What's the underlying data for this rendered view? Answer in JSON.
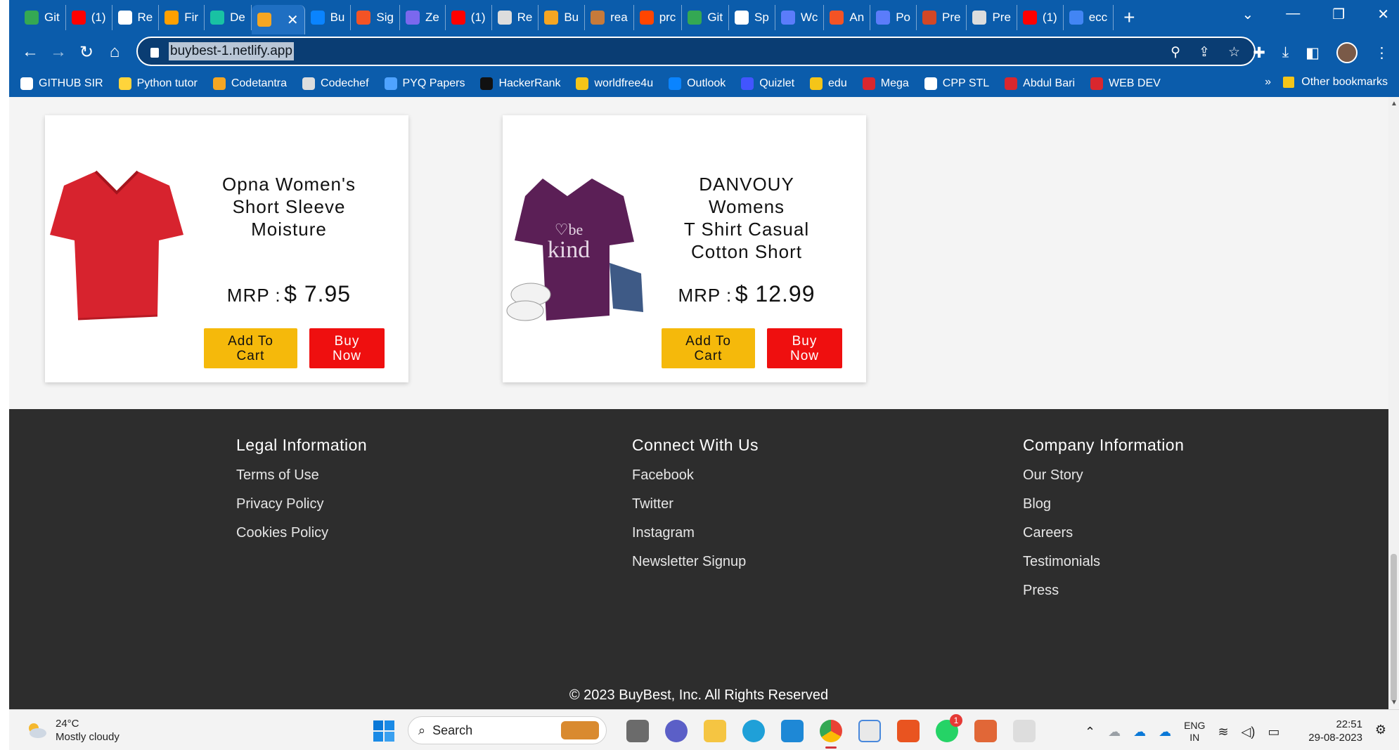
{
  "browser": {
    "tabs": [
      {
        "label": "Git",
        "color": "#34a853"
      },
      {
        "label": "(1)",
        "color": "#ff0000"
      },
      {
        "label": "Re",
        "color": "#ffffff"
      },
      {
        "label": "Fir",
        "color": "#ffa000"
      },
      {
        "label": "De",
        "color": "#19c2a3"
      },
      {
        "label": "",
        "color": "#f5a623",
        "active": true
      },
      {
        "label": "Bu",
        "color": "#0a84ff"
      },
      {
        "label": "Sig",
        "color": "#f35325"
      },
      {
        "label": "Ze",
        "color": "#7b68ee"
      },
      {
        "label": "(1)",
        "color": "#ff0000"
      },
      {
        "label": "Re",
        "color": "#dddddd"
      },
      {
        "label": "Bu",
        "color": "#f5a623"
      },
      {
        "label": "rea",
        "color": "#c67a3a"
      },
      {
        "label": "prc",
        "color": "#ff4500"
      },
      {
        "label": "Git",
        "color": "#34a853"
      },
      {
        "label": "Sp",
        "color": "#ffffff"
      },
      {
        "label": "Wc",
        "color": "#5b7cfa"
      },
      {
        "label": "An",
        "color": "#f35325"
      },
      {
        "label": "Po",
        "color": "#5b7cfa"
      },
      {
        "label": "Pre",
        "color": "#d24726"
      },
      {
        "label": "Pre",
        "color": "#dddddd"
      },
      {
        "label": "(1)",
        "color": "#ff0000"
      },
      {
        "label": "ecc",
        "color": "#4285f4"
      }
    ],
    "active_tab_close": "✕",
    "new_tab": "+",
    "window_controls": [
      "⌄",
      "—",
      "❐",
      "✕"
    ],
    "url": "buybest-1.netlify.app",
    "bookmarks": [
      {
        "label": "GITHUB SIR",
        "color": "#ffffff"
      },
      {
        "label": "Python tutor",
        "color": "#ffd43b"
      },
      {
        "label": "Codetantra",
        "color": "#f5a623"
      },
      {
        "label": "Codechef",
        "color": "#dddddd"
      },
      {
        "label": "PYQ Papers",
        "color": "#4fa3ff"
      },
      {
        "label": "HackerRank",
        "color": "#111111"
      },
      {
        "label": "worldfree4u",
        "color": "#f5c518"
      },
      {
        "label": "Outlook",
        "color": "#0a84ff"
      },
      {
        "label": "Quizlet",
        "color": "#4255ff"
      },
      {
        "label": "edu",
        "color": "#f5c518"
      },
      {
        "label": "Mega",
        "color": "#d9272e"
      },
      {
        "label": "CPP STL",
        "color": "#ffffff"
      },
      {
        "label": "Abdul Bari",
        "color": "#d9272e"
      },
      {
        "label": "WEB DEV",
        "color": "#d9272e"
      }
    ],
    "bookmarks_more": "»",
    "other_bookmarks": "Other bookmarks"
  },
  "products": [
    {
      "title_lines": [
        "Opna Women's",
        "Short Sleeve",
        "Moisture"
      ],
      "mrp_label": "MRP :",
      "price": "$ 7.95",
      "add_to_cart": [
        "Add To",
        "Cart"
      ],
      "buy_now": [
        "Buy",
        "Now"
      ],
      "image": "red-tshirt"
    },
    {
      "title_lines": [
        "DANVOUY Womens",
        "T Shirt Casual",
        "Cotton Short"
      ],
      "mrp_label": "MRP :",
      "price": "$ 12.99",
      "add_to_cart": [
        "Add To",
        "Cart"
      ],
      "buy_now": [
        "Buy",
        "Now"
      ],
      "image": "purple-be-kind-tshirt",
      "image_text": [
        "♡be",
        "kind"
      ]
    }
  ],
  "footer": {
    "columns": [
      {
        "heading": "Legal Information",
        "links": [
          "Terms of Use",
          "Privacy Policy",
          "Cookies Policy"
        ]
      },
      {
        "heading": "Connect With Us",
        "links": [
          "Facebook",
          "Twitter",
          "Instagram",
          "Newsletter Signup"
        ]
      },
      {
        "heading": "Company Information",
        "links": [
          "Our Story",
          "Blog",
          "Careers",
          "Testimonials",
          "Press"
        ]
      }
    ],
    "copyright": "© 2023 BuyBest, Inc. All Rights Reserved"
  },
  "taskbar": {
    "weather_temp": "24°C",
    "weather_desc": "Mostly cloudy",
    "search_label": "Search",
    "lang_line1": "ENG",
    "lang_line2": "IN",
    "time": "22:51",
    "date": "29-08-2023",
    "whatsapp_badge": "1"
  },
  "colors": {
    "chrome_blue": "#0b5cab",
    "add_to_cart": "#f5b90b",
    "buy_now": "#ef0f0f",
    "footer_bg": "#2d2d2d"
  }
}
